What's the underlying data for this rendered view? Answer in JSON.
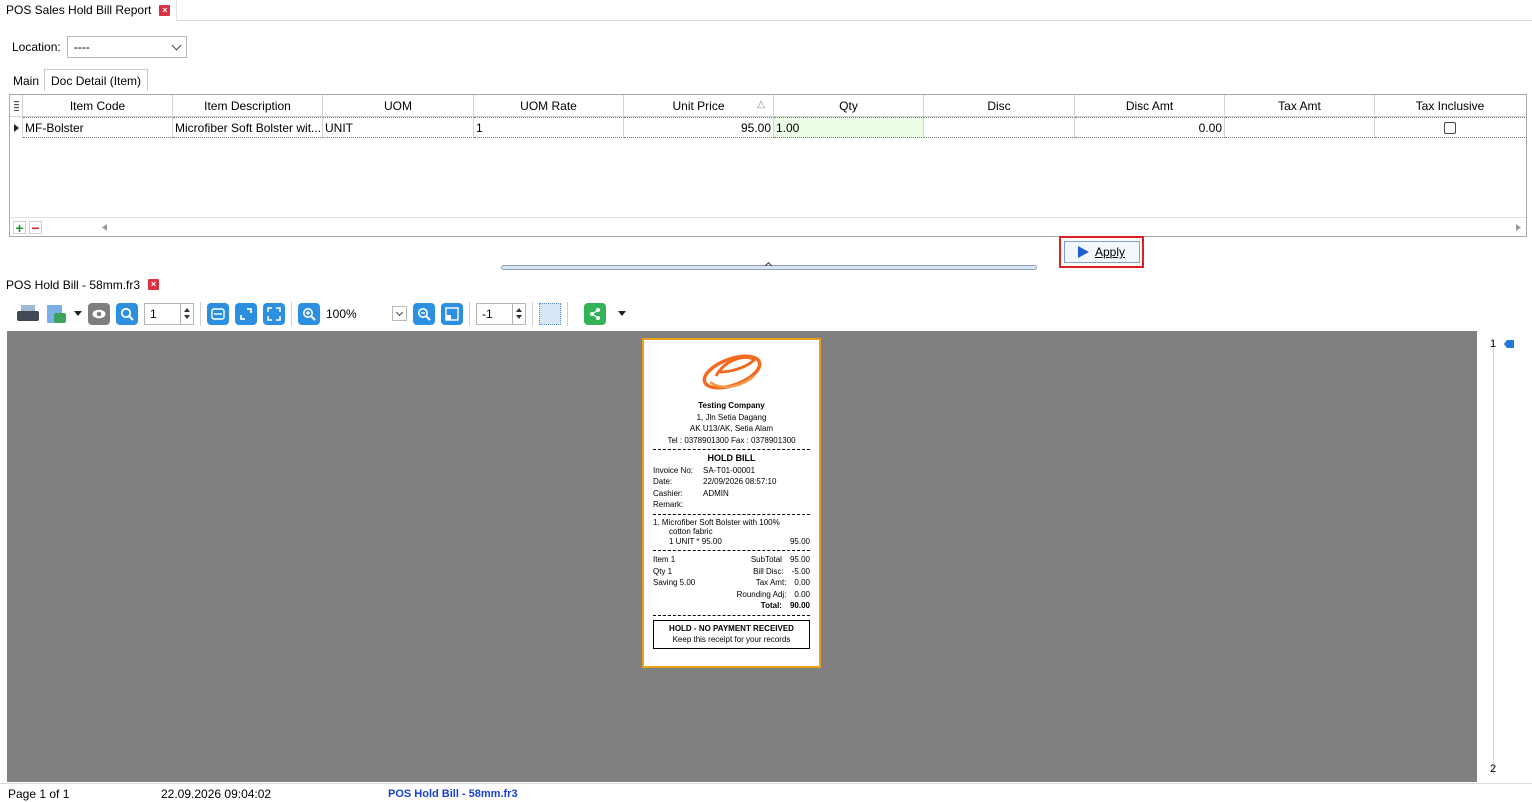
{
  "top_tab": {
    "title": "POS Sales Hold Bill Report",
    "close": "×"
  },
  "filter": {
    "location_label": "Location:",
    "location_value": "----"
  },
  "subtabs": [
    "Main",
    "Doc Detail (Item)"
  ],
  "grid": {
    "indicator_icon": "column-chooser-icon",
    "columns": [
      "Item Code",
      "Item Description",
      "UOM",
      "UOM Rate",
      "Unit Price",
      "Qty",
      "Disc",
      "Disc Amt",
      "Tax Amt",
      "Tax Inclusive"
    ],
    "sort_glyph": "△",
    "rows": [
      {
        "item_code": "MF-Bolster",
        "item_description": "Microfiber Soft Bolster wit...",
        "uom": "UNIT",
        "uom_rate": "1",
        "unit_price": "95.00",
        "qty": "1.00",
        "disc": "",
        "disc_amt": "0.00",
        "tax_amt": "",
        "tax_inclusive": false
      }
    ],
    "add": "+",
    "remove": "−"
  },
  "apply_button": {
    "label": "Apply"
  },
  "preview_tab": {
    "title": "POS Hold Bill - 58mm.fr3",
    "close": "×"
  },
  "toolbar": {
    "page_input": "1",
    "zoom": "100%",
    "offset_input": "-1"
  },
  "page_nav": {
    "first": "1",
    "last": "2"
  },
  "receipt": {
    "company": "Testing Company",
    "address1": "1, Jln Setia Dagang",
    "address2": "AK U13/AK, Setia Alam",
    "phone": "Tel : 0378901300    Fax : 0378901300",
    "title": "HOLD BILL",
    "info": [
      {
        "label": "Invoice No:",
        "value": "SA-T01-00001"
      },
      {
        "label": "Date:",
        "value": "22/09/2026 08:57:10"
      },
      {
        "label": "Cashier:",
        "value": "ADMIN"
      },
      {
        "label": "Remark:",
        "value": ""
      }
    ],
    "item_line1": "1.   Microfiber Soft Bolster with 100%",
    "item_line2": "cotton fabric",
    "item_qty_price": "1 UNIT * 95.00",
    "item_amount": "95.00",
    "summary": [
      {
        "left": "Item 1",
        "label": "SubTotal",
        "value": "95.00"
      },
      {
        "left": "Qty 1",
        "label": "Bill Disc:",
        "value": "-5.00"
      },
      {
        "left": "Saving 5.00",
        "label": "Tax Amt:",
        "value": "0.00"
      },
      {
        "left": "",
        "label": "Rounding Adj:",
        "value": "0.00"
      }
    ],
    "total_label": "Total:",
    "total_value": "90.00",
    "footer1": "HOLD - NO PAYMENT RECEIVED",
    "footer2": "Keep this receipt for your records"
  },
  "status": {
    "page": "Page 1 of 1",
    "datetime": "22.09.2026 09:04:02",
    "report": "POS Hold Bill - 58mm.fr3"
  },
  "colors": {
    "accent": "#1f5fd1",
    "highlight_border": "#e02020",
    "receipt_border": "#e6a11a",
    "preview_bg": "#808080"
  }
}
